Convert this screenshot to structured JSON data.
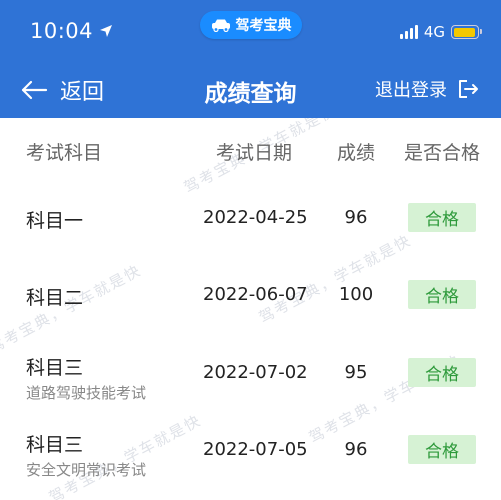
{
  "status_bar": {
    "time": "10:04",
    "app_badge": "驾考宝典",
    "network": "4G",
    "battery_level": 0.95
  },
  "nav": {
    "back_label": "返回",
    "title": "成绩查询",
    "logout_label": "退出登录"
  },
  "table": {
    "headers": {
      "subject": "考试科目",
      "date": "考试日期",
      "score": "成绩",
      "passed": "是否合格"
    },
    "rows": [
      {
        "subject": "科目一",
        "subtitle": "",
        "date": "2022-04-25",
        "score": "96",
        "status": "合格"
      },
      {
        "subject": "科目二",
        "subtitle": "",
        "date": "2022-06-07",
        "score": "100",
        "status": "合格"
      },
      {
        "subject": "科目三",
        "subtitle": "道路驾驶技能考试",
        "date": "2022-07-02",
        "score": "95",
        "status": "合格"
      },
      {
        "subject": "科目三",
        "subtitle": "安全文明常识考试",
        "date": "2022-07-05",
        "score": "96",
        "status": "合格"
      }
    ]
  },
  "watermark": "驾考宝典，学车就是快",
  "colors": {
    "header_bg": "#2f73d6",
    "pill_bg": "#1a8cff",
    "badge_bg": "#d6f2d4",
    "badge_text": "#2e9a3b",
    "battery": "#f4c800"
  }
}
